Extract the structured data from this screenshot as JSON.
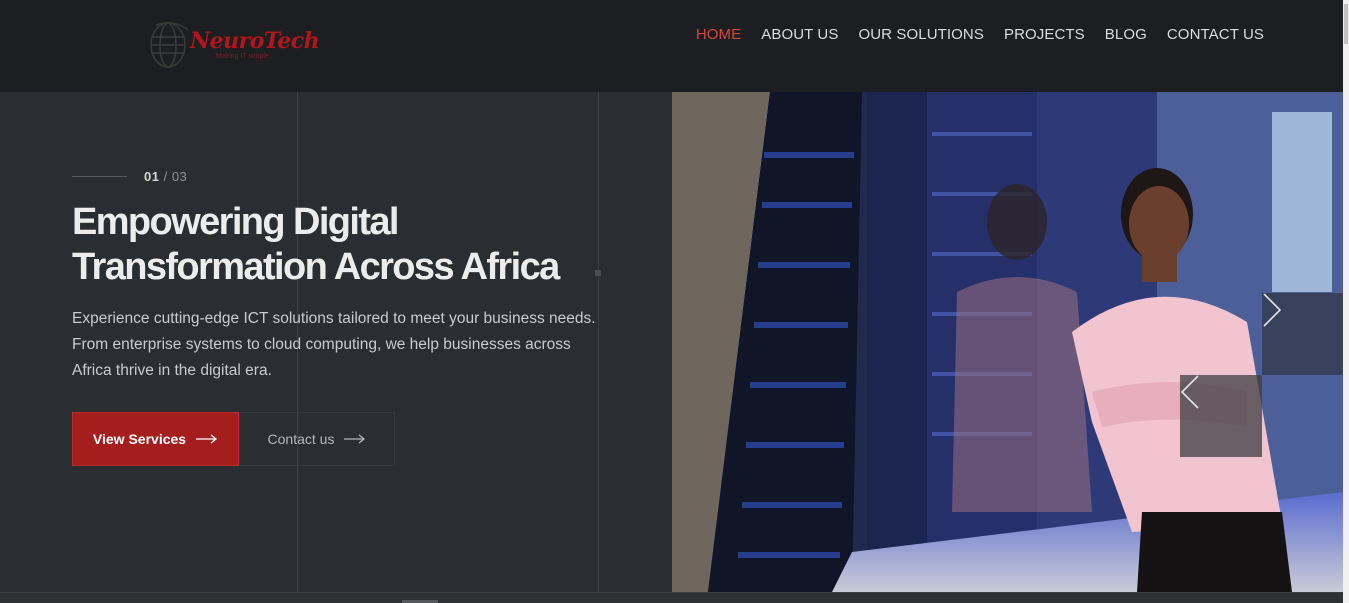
{
  "brand": {
    "name": "NeuroTech",
    "tagline": "Making IT simple"
  },
  "nav": {
    "items": [
      {
        "label": "HOME",
        "active": true
      },
      {
        "label": "ABOUT US",
        "active": false
      },
      {
        "label": "OUR SOLUTIONS",
        "active": false
      },
      {
        "label": "PROJECTS",
        "active": false
      },
      {
        "label": "BLOG",
        "active": false
      },
      {
        "label": "CONTACT US",
        "active": false
      }
    ]
  },
  "hero": {
    "counter_current": "01",
    "counter_sep": " / ",
    "counter_total": "03",
    "headline_line1": "Empowering Digital",
    "headline_line2": "Transformation Across Africa",
    "description": "Experience cutting-edge ICT solutions tailored to meet your business needs. From enterprise systems to cloud computing, we help businesses across Africa thrive in the digital era.",
    "primary_button": "View Services",
    "secondary_button": "Contact us"
  },
  "slider": {
    "next_icon": "chevron-right-icon",
    "prev_icon": "chevron-left-icon"
  },
  "colors": {
    "accent": "#a51e1e",
    "nav_active": "#d8443e",
    "header_bg": "#1d1e21",
    "hero_bg": "#2a2d31"
  }
}
